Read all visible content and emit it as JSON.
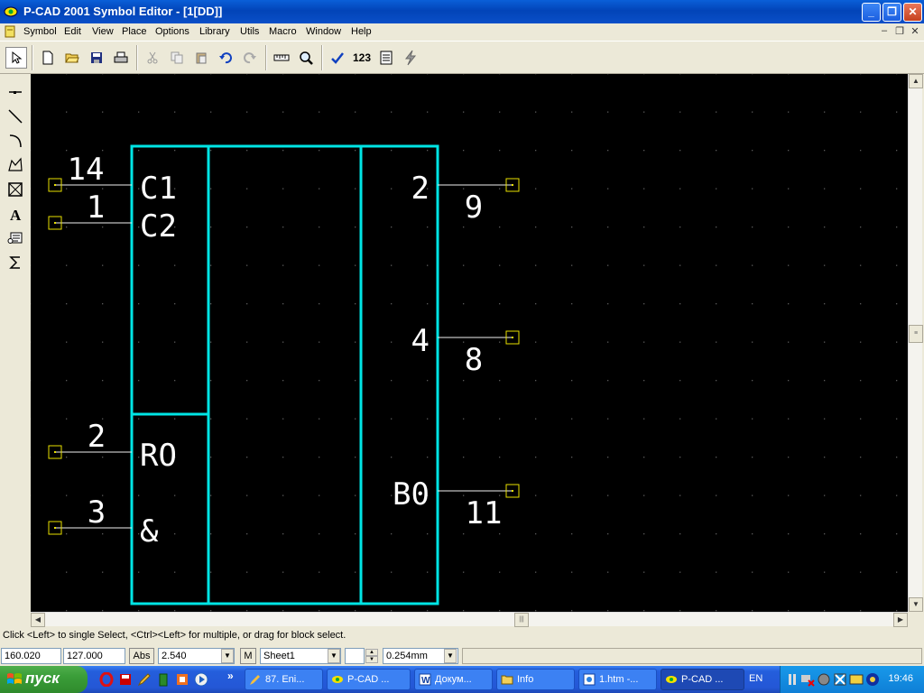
{
  "window": {
    "title": "P-CAD 2001 Symbol Editor - [1[DD]]"
  },
  "menu": [
    "Symbol",
    "Edit",
    "View",
    "Place",
    "Options",
    "Library",
    "Utils",
    "Macro",
    "Window",
    "Help"
  ],
  "toolbar": {
    "numbers_label": "123"
  },
  "symbol": {
    "left_pins": [
      "14",
      "1",
      "2",
      "3"
    ],
    "left_labels": [
      "C1",
      "C2",
      "RO",
      "&"
    ],
    "right_pins": [
      "9",
      "8",
      "11"
    ],
    "right_labels": [
      "2",
      "4",
      "B0"
    ]
  },
  "status": {
    "message": "Click <Left> to single Select, <Ctrl><Left> for multiple, or drag for block select.",
    "x": "160.020",
    "y": "127.000",
    "abs_label": "Abs",
    "grid": "2.540",
    "m_label": "M",
    "sheet": "Sheet1",
    "line_width": "0.254mm"
  },
  "taskbar": {
    "start_label": "пуск",
    "tasks": [
      "87. Eni...",
      "P-CAD ...",
      "Докум...",
      "Info",
      "1.htm -...",
      "P-CAD ..."
    ],
    "language": "EN",
    "clock": "19:46"
  },
  "colors": {
    "outline": "#00e5e5",
    "pin": "#f0f0f0",
    "pin_marker": "#e8e000",
    "label": "#ffffff",
    "grid_dot": "#5a5a5a"
  }
}
